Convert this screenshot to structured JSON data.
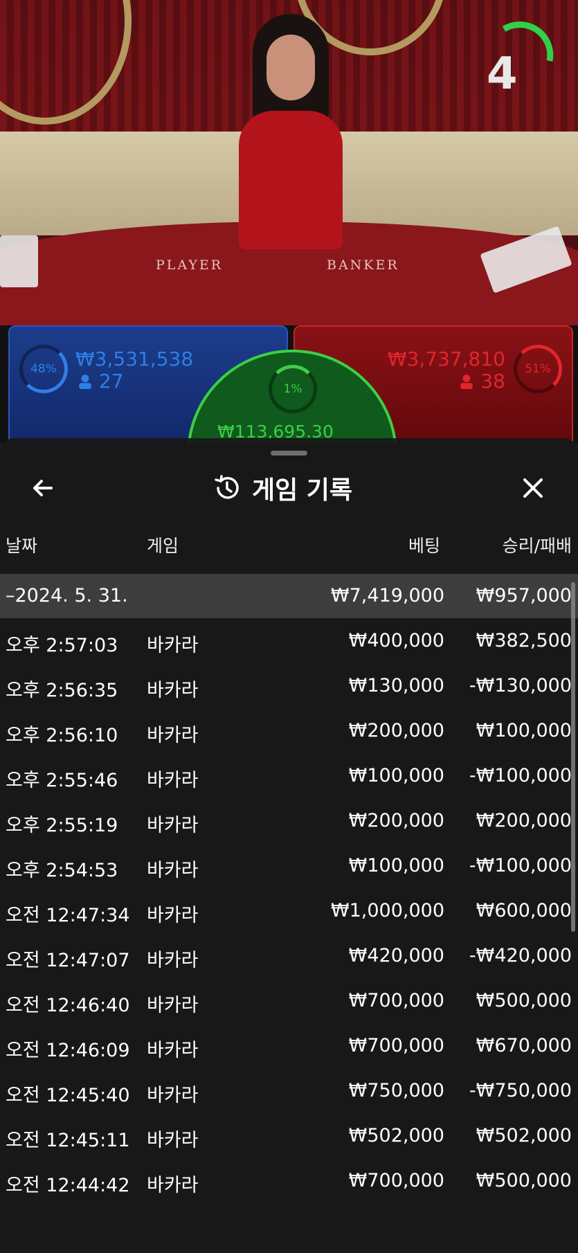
{
  "stream": {
    "countdown": "4",
    "felt_player": "PLAYER",
    "felt_banker": "BANKER"
  },
  "bets": {
    "player": {
      "percent": "48%",
      "amount": "₩3,531,538",
      "players": "27"
    },
    "banker": {
      "percent": "51%",
      "amount": "₩3,737,810",
      "players": "38"
    },
    "tie": {
      "percent": "1%",
      "amount": "₩113,695.30"
    }
  },
  "history": {
    "title": "게임 기록",
    "headers": {
      "date": "날짜",
      "game": "게임",
      "bet": "베팅",
      "result": "승리/패배"
    },
    "summary": {
      "date": "–2024. 5. 31.",
      "bet": "₩7,419,000",
      "result": "₩957,000"
    },
    "rows": [
      {
        "time": "오후 2:57:03",
        "game": "바카라",
        "bet": "₩400,000",
        "result": "₩382,500"
      },
      {
        "time": "오후 2:56:35",
        "game": "바카라",
        "bet": "₩130,000",
        "result": "-₩130,000"
      },
      {
        "time": "오후 2:56:10",
        "game": "바카라",
        "bet": "₩200,000",
        "result": "₩100,000"
      },
      {
        "time": "오후 2:55:46",
        "game": "바카라",
        "bet": "₩100,000",
        "result": "-₩100,000"
      },
      {
        "time": "오후 2:55:19",
        "game": "바카라",
        "bet": "₩200,000",
        "result": "₩200,000"
      },
      {
        "time": "오후 2:54:53",
        "game": "바카라",
        "bet": "₩100,000",
        "result": "-₩100,000"
      },
      {
        "time": "오전 12:47:34",
        "game": "바카라",
        "bet": "₩1,000,000",
        "result": "₩600,000"
      },
      {
        "time": "오전 12:47:07",
        "game": "바카라",
        "bet": "₩420,000",
        "result": "-₩420,000"
      },
      {
        "time": "오전 12:46:40",
        "game": "바카라",
        "bet": "₩700,000",
        "result": "₩500,000"
      },
      {
        "time": "오전 12:46:09",
        "game": "바카라",
        "bet": "₩700,000",
        "result": "₩670,000"
      },
      {
        "time": "오전 12:45:40",
        "game": "바카라",
        "bet": "₩750,000",
        "result": "-₩750,000"
      },
      {
        "time": "오전 12:45:11",
        "game": "바카라",
        "bet": "₩502,000",
        "result": "₩502,000"
      },
      {
        "time": "오전 12:44:42",
        "game": "바카라",
        "bet": "₩700,000",
        "result": "₩500,000"
      }
    ]
  },
  "colors": {
    "player_blue": "#2f7fe6",
    "banker_red": "#e0262c",
    "tie_green": "#3ccf46",
    "timer_green": "#2fd14a"
  }
}
